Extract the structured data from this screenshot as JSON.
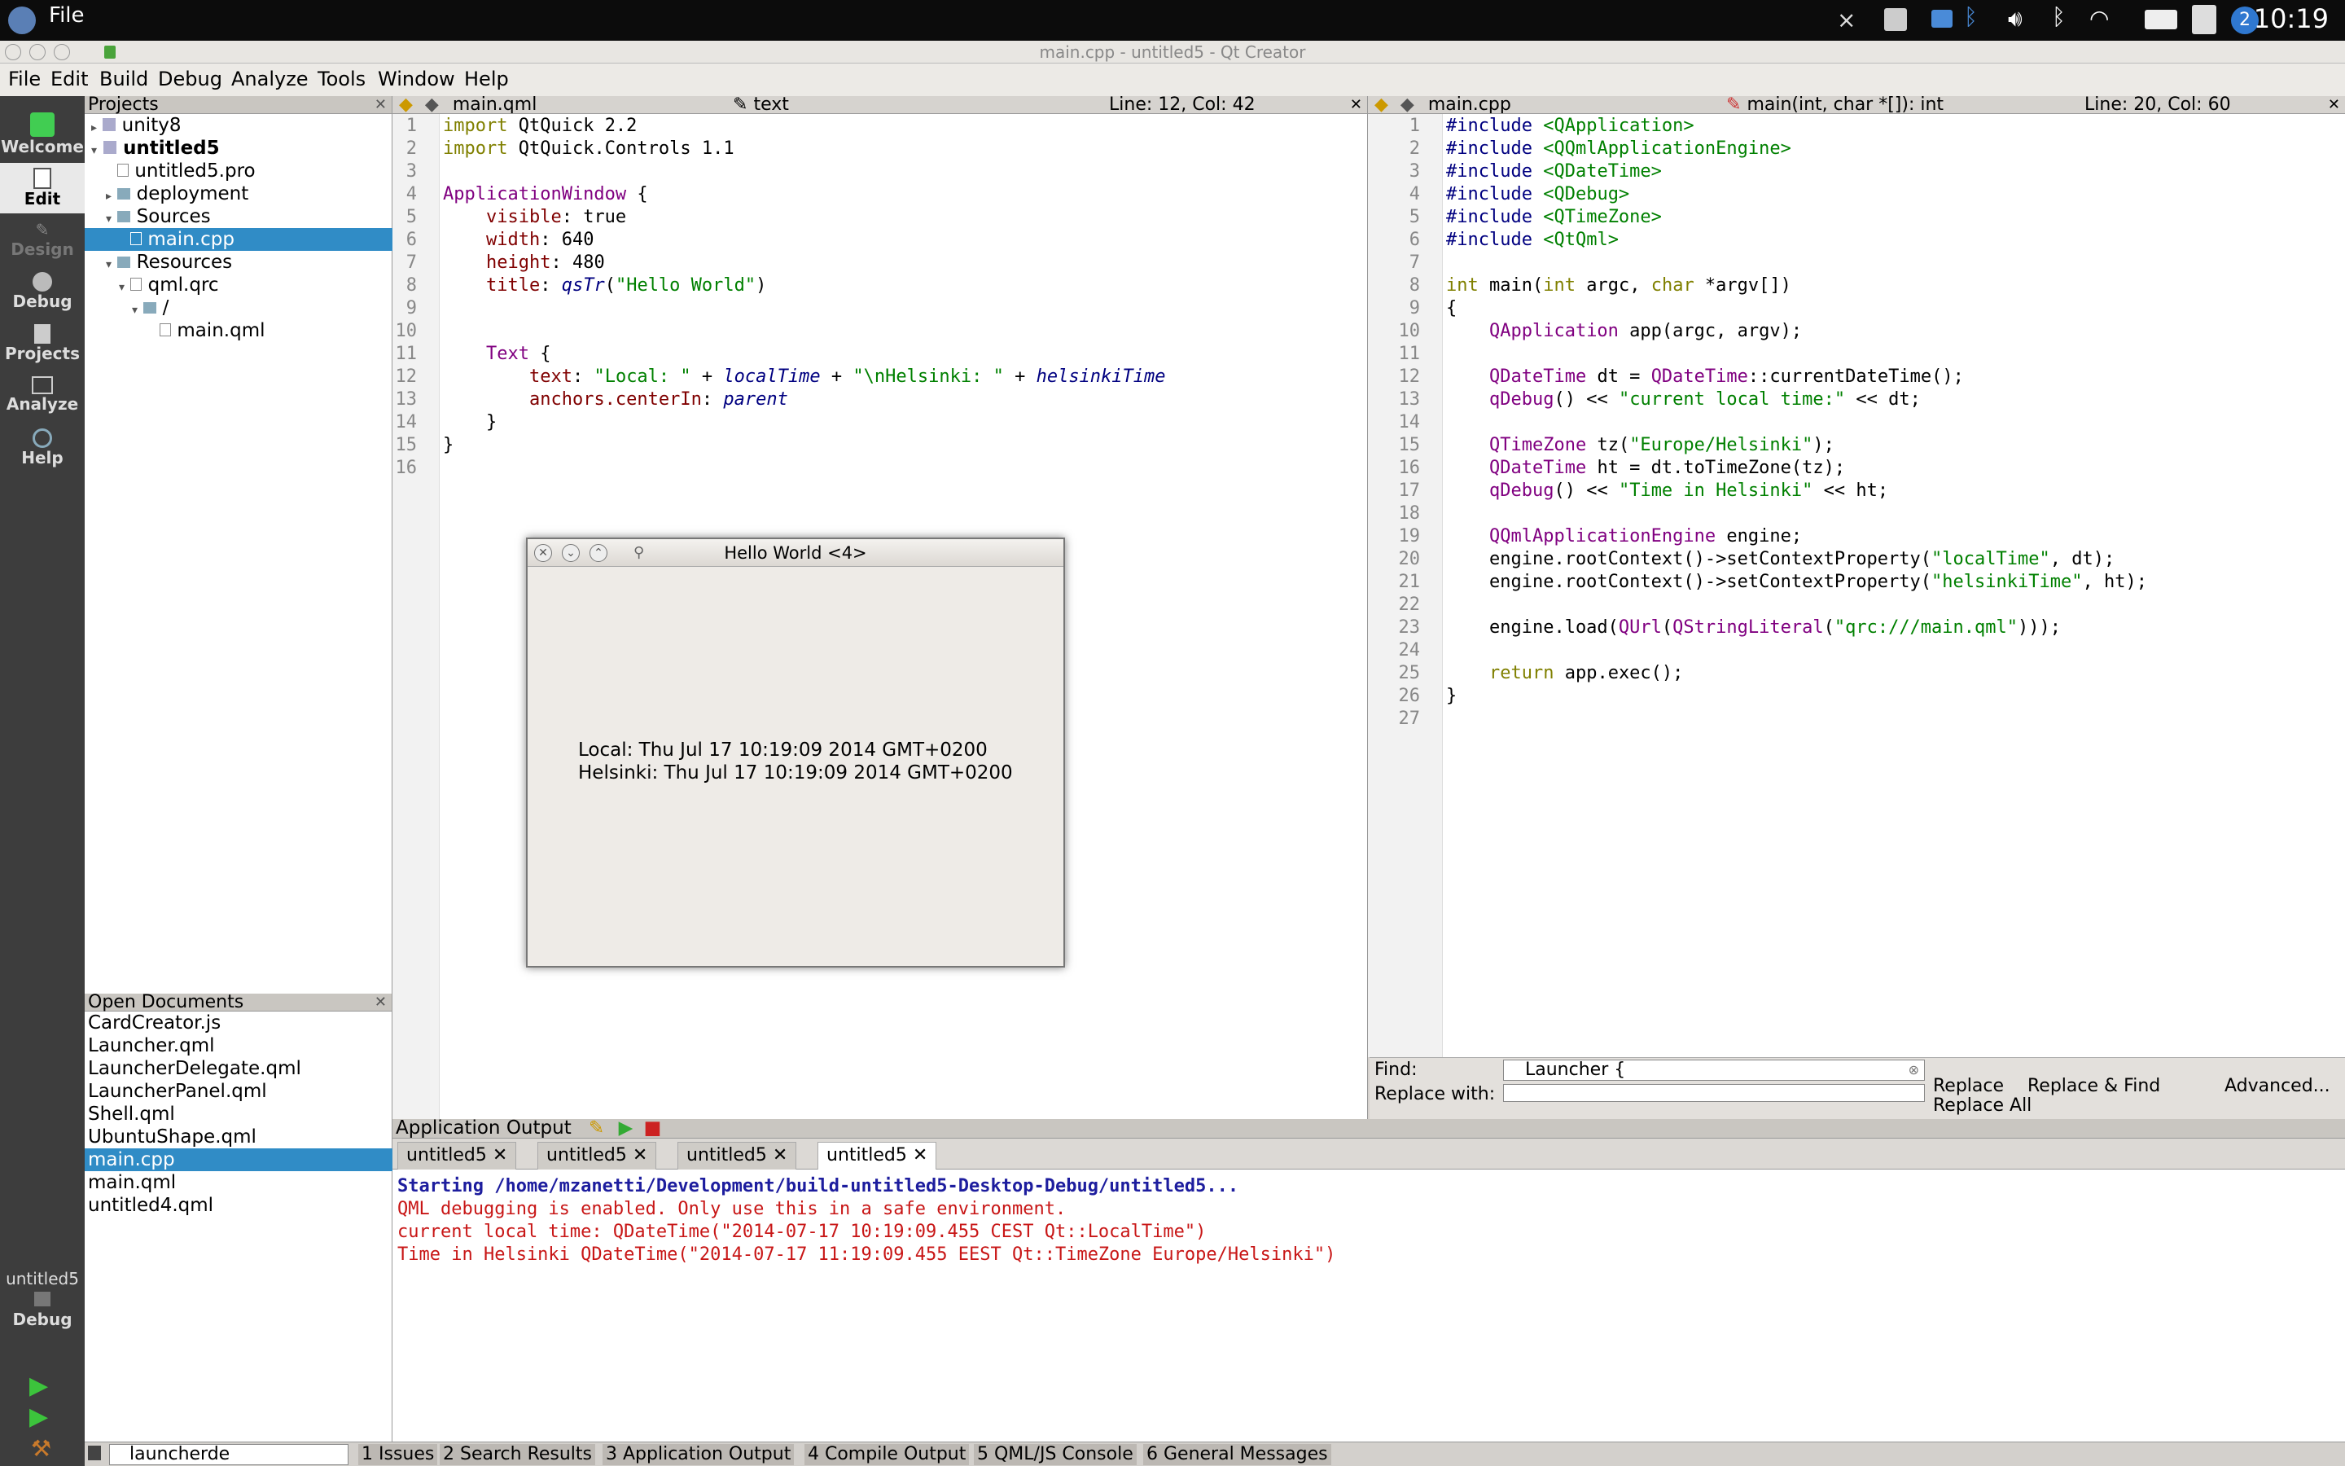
{
  "top_panel": {
    "menu": "File",
    "clock": "10:19",
    "workspace_badge": "2"
  },
  "window_title": "main.cpp - untitled5 - Qt Creator",
  "menubar": [
    "File",
    "Edit",
    "Build",
    "Debug",
    "Analyze",
    "Tools",
    "Window",
    "Help"
  ],
  "modes": [
    "Welcome",
    "Edit",
    "Design",
    "Debug",
    "Projects",
    "Analyze",
    "Help"
  ],
  "kit": {
    "project": "untitled5",
    "config": "Debug"
  },
  "projects": {
    "title": "Projects",
    "tree": [
      {
        "label": "unity8",
        "indent": 0
      },
      {
        "label": "untitled5",
        "indent": 0
      },
      {
        "label": "untitled5.pro",
        "indent": 1
      },
      {
        "label": "deployment",
        "indent": 1
      },
      {
        "label": "Sources",
        "indent": 1
      },
      {
        "label": "main.cpp",
        "indent": 2
      },
      {
        "label": "Resources",
        "indent": 1
      },
      {
        "label": "qml.qrc",
        "indent": 2
      },
      {
        "label": "/",
        "indent": 3
      },
      {
        "label": "main.qml",
        "indent": 4
      }
    ]
  },
  "open_documents": {
    "title": "Open Documents",
    "items": [
      "CardCreator.js",
      "Launcher.qml",
      "LauncherDelegate.qml",
      "LauncherPanel.qml",
      "Shell.qml",
      "UbuntuShape.qml",
      "main.cpp",
      "main.qml",
      "untitled4.qml"
    ]
  },
  "left_editor": {
    "file": "main.qml",
    "symbol": "text",
    "position": "Line: 12, Col: 42",
    "lines": [
      "import QtQuick 2.2",
      "import QtQuick.Controls 1.1",
      "",
      "ApplicationWindow {",
      "    visible: true",
      "    width: 640",
      "    height: 480",
      "    title: qsTr(\"Hello World\")",
      "",
      "",
      "    Text {",
      "        text: \"Local: \" + localTime + \"\\nHelsinki: \" + helsinkiTime",
      "        anchors.centerIn: parent",
      "    }",
      "}",
      ""
    ]
  },
  "right_editor": {
    "file": "main.cpp",
    "symbol": "main(int, char *[]): int",
    "position": "Line: 20, Col: 60",
    "lines": [
      "#include <QApplication>",
      "#include <QQmlApplicationEngine>",
      "#include <QDateTime>",
      "#include <QDebug>",
      "#include <QTimeZone>",
      "#include <QtQml>",
      "",
      "int main(int argc, char *argv[])",
      "{",
      "    QApplication app(argc, argv);",
      "",
      "    QDateTime dt = QDateTime::currentDateTime();",
      "    qDebug() << \"current local time:\" << dt;",
      "",
      "    QTimeZone tz(\"Europe/Helsinki\");",
      "    QDateTime ht = dt.toTimeZone(tz);",
      "    qDebug() << \"Time in Helsinki\" << ht;",
      "",
      "    QQmlApplicationEngine engine;",
      "    engine.rootContext()->setContextProperty(\"localTime\", dt);",
      "    engine.rootContext()->setContextProperty(\"helsinkiTime\", ht);",
      "",
      "    engine.load(QUrl(QStringLiteral(\"qrc:///main.qml\")));",
      "",
      "    return app.exec();",
      "}",
      ""
    ]
  },
  "find": {
    "find_label": "Find:",
    "find_value": "Launcher {",
    "replace_label": "Replace with:",
    "replace_value": "",
    "replace_btn": "Replace",
    "replace_find_btn": "Replace & Find",
    "replace_all_btn": "Replace All",
    "advanced_btn": "Advanced..."
  },
  "output": {
    "title": "Application Output",
    "tabs": [
      "untitled5",
      "untitled5",
      "untitled5",
      "untitled5"
    ],
    "lines": [
      {
        "text": "Starting /home/mzanetti/Development/build-untitled5-Desktop-Debug/untitled5...",
        "color": "#1d1d9e",
        "bold": true
      },
      {
        "text": "QML debugging is enabled. Only use this in a safe environment.",
        "color": "#c81616",
        "bold": false
      },
      {
        "text": "current local time: QDateTime(\"2014-07-17 10:19:09.455 CEST Qt::LocalTime\")",
        "color": "#c81616",
        "bold": false
      },
      {
        "text": "Time in Helsinki QDateTime(\"2014-07-17 11:19:09.455 EEST Qt::TimeZone Europe/Helsinki\")",
        "color": "#c81616",
        "bold": false
      }
    ]
  },
  "status_bar": {
    "locator_value": "launcherde",
    "tabs": [
      "1 Issues",
      "2 Search Results",
      "3 Application Output",
      "4 Compile Output",
      "5 QML/JS Console",
      "6 General Messages"
    ]
  },
  "hello_window": {
    "title": "Hello World <4>",
    "line1": "Local: Thu Jul 17 10:19:09 2014 GMT+0200",
    "line2": "Helsinki: Thu Jul 17 10:19:09 2014 GMT+0200"
  }
}
